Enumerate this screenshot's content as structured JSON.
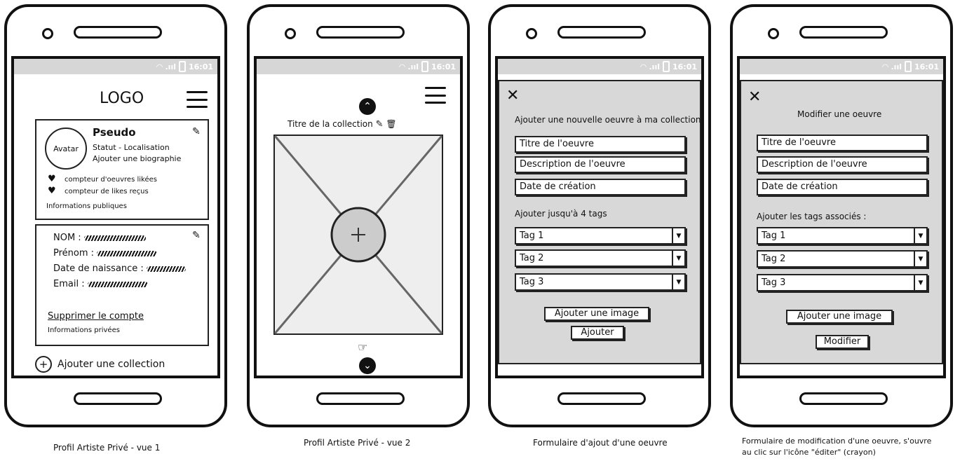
{
  "status": {
    "time": "16:01"
  },
  "screen1": {
    "logo": "LOGO",
    "profile": {
      "avatar": "Avatar",
      "pseudo": "Pseudo",
      "status": "Statut - Localisation",
      "bio": "Ajouter une biographie",
      "liked_counter": "compteur d'oeuvres likées",
      "likes_received": "compteur de likes reçus",
      "section_label": "Informations publiques"
    },
    "private": {
      "nom": "NOM :",
      "prenom": "Prénom :",
      "birth": "Date de naissance :",
      "email": "Email :",
      "delete": "Supprimer le compte",
      "section_label": "Informations privées"
    },
    "add_collection": "Ajouter une collection",
    "caption": "Profil Artiste Privé - vue 1"
  },
  "screen2": {
    "collection_title": "Titre de la collection",
    "caption": "Profil Artiste Privé - vue 2"
  },
  "screen3": {
    "heading": "Ajouter une nouvelle oeuvre à ma collection",
    "title_field": "Titre de l'oeuvre",
    "desc_field": "Description de l'oeuvre",
    "date_field": "Date de création",
    "tags_label": "Ajouter jusqu'à 4 tags",
    "tags": [
      "Tag 1",
      "Tag 2",
      "Tag 3"
    ],
    "add_image": "Ajouter une image",
    "submit": "Ajouter",
    "caption": "Formulaire d'ajout d'une oeuvre"
  },
  "screen4": {
    "heading": "Modifier une oeuvre",
    "title_field": "Titre de l'oeuvre",
    "desc_field": "Description de l'oeuvre",
    "date_field": "Date de création",
    "tags_label": "Ajouter les tags associés :",
    "tags": [
      "Tag 1",
      "Tag 2",
      "Tag 3"
    ],
    "add_image": "Ajouter une image",
    "submit": "Modifier",
    "caption_line1": "Formulaire de modification d'une oeuvre, s'ouvre",
    "caption_line2": "au clic sur l'icône \"éditer\" (crayon)"
  }
}
